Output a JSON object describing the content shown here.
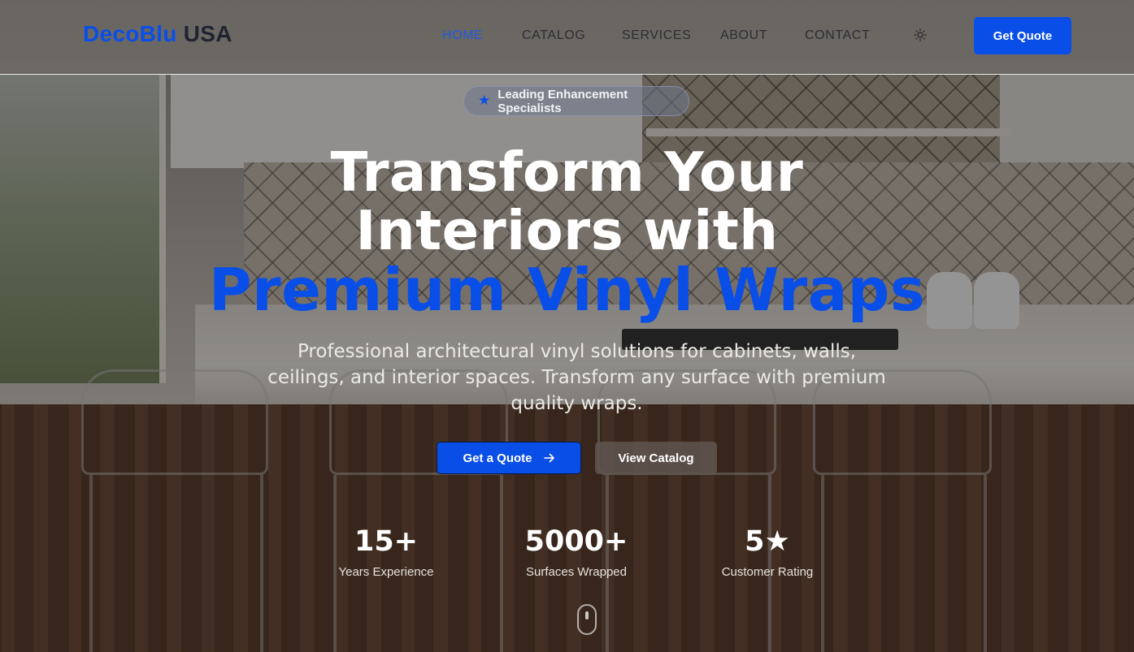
{
  "header": {
    "logo_brand": "DecoBlu",
    "logo_region": "USA",
    "nav": [
      {
        "label": "HOME",
        "active": true
      },
      {
        "label": "CATALOG",
        "active": false
      },
      {
        "label": "SERVICES",
        "active": false
      },
      {
        "label": "ABOUT",
        "active": false
      },
      {
        "label": "CONTACT",
        "active": false
      }
    ],
    "theme_icon": "sun-icon",
    "quote_button": "Get Quote"
  },
  "hero": {
    "badge": {
      "icon": "star-icon",
      "text": "Leading Enhancement Specialists"
    },
    "headline_line1": "Transform Your",
    "headline_line2": "Interiors with",
    "headline_accent": "Premium Vinyl Wraps",
    "subtitle": "Professional architectural vinyl solutions for cabinets, walls, ceilings, and interior spaces. Transform any surface with premium quality wraps.",
    "cta_primary": "Get a Quote",
    "cta_primary_icon": "arrow-right-icon",
    "cta_secondary": "View Catalog",
    "stats": [
      {
        "value": "15+",
        "label": "Years Experience"
      },
      {
        "value": "5000+",
        "label": "Surfaces Wrapped"
      },
      {
        "value": "5★",
        "label": "Customer Rating"
      }
    ],
    "scroll_icon": "mouse-scroll-icon"
  },
  "colors": {
    "accent": "#0a4ee8",
    "nav_text": "#2c2d33",
    "logo_region": "#1f2430"
  }
}
